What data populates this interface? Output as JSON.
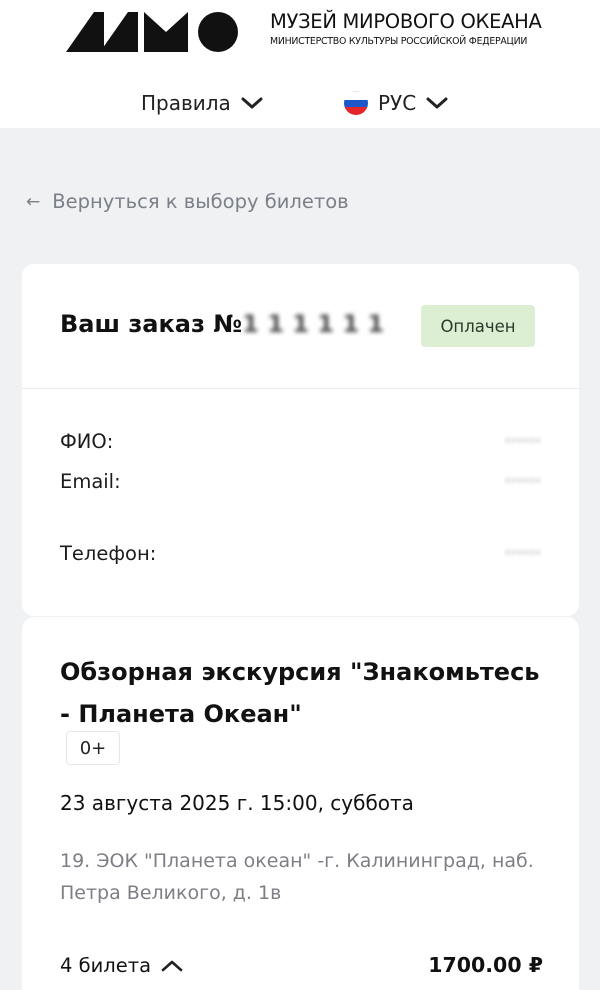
{
  "header": {
    "logo_icon": "mmo-logo-icon",
    "brand_title": "МУЗЕЙ МИРОВОГО ОКЕАНА",
    "brand_subtitle": "МИНИСТЕРСТВО КУЛЬТУРЫ РОССИЙСКОЙ ФЕДЕРАЦИИ",
    "rules_label": "Правила",
    "language_label": "РУС",
    "flag_colors": [
      "#ffffff",
      "#1c57c9",
      "#e3262a"
    ]
  },
  "back_link": "Вернуться к выбору билетов",
  "order": {
    "title_prefix": "Ваш заказ №",
    "number_masked": "1 1 1 1 1 1",
    "status": "Оплачен",
    "status_color": "#dcefd2",
    "fields": {
      "name_label": "ФИО:",
      "name_value": "······",
      "email_label": "Email:",
      "email_value": "······",
      "phone_label": "Телефон:",
      "phone_value": "······"
    }
  },
  "event": {
    "title": "Обзорная экскурсия \"Знакомьтесь - Планета Океан\"",
    "age_rating": "0+",
    "datetime": "23 августа 2025 г. 15:00, суббота",
    "place": "19. ЭОК \"Планета океан\" -г. Калининград, наб. Петра Великого, д. 1в",
    "tickets": "4 билета",
    "price": "1700.00 ₽"
  }
}
